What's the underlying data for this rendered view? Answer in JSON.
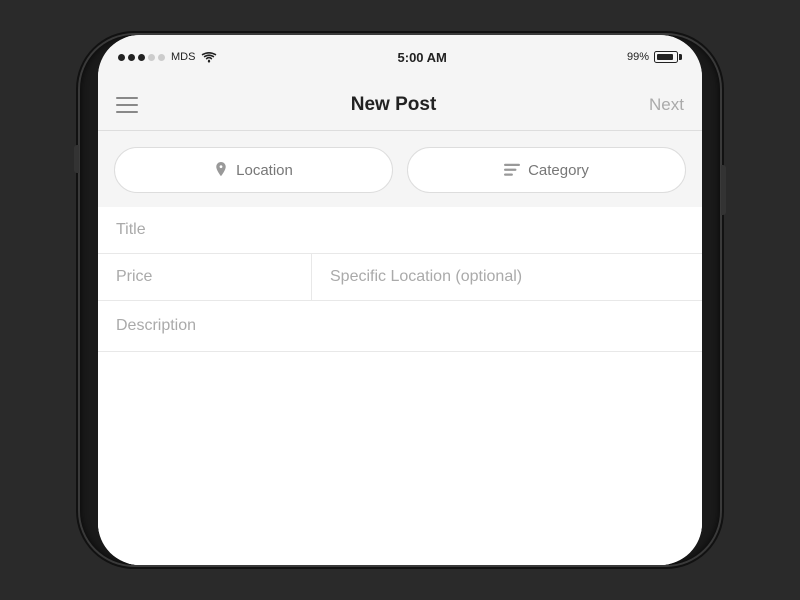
{
  "status_bar": {
    "carrier": "MDS",
    "time": "5:00 AM",
    "battery_percent": "99%"
  },
  "nav": {
    "title": "New Post",
    "next_label": "Next",
    "menu_icon": "hamburger"
  },
  "buttons": {
    "location_label": "Location",
    "category_label": "Category",
    "location_icon": "📍",
    "category_icon": "≡"
  },
  "form": {
    "title_placeholder": "Title",
    "price_placeholder": "Price",
    "specific_location_placeholder": "Specific Location (optional)",
    "description_placeholder": "Description"
  }
}
